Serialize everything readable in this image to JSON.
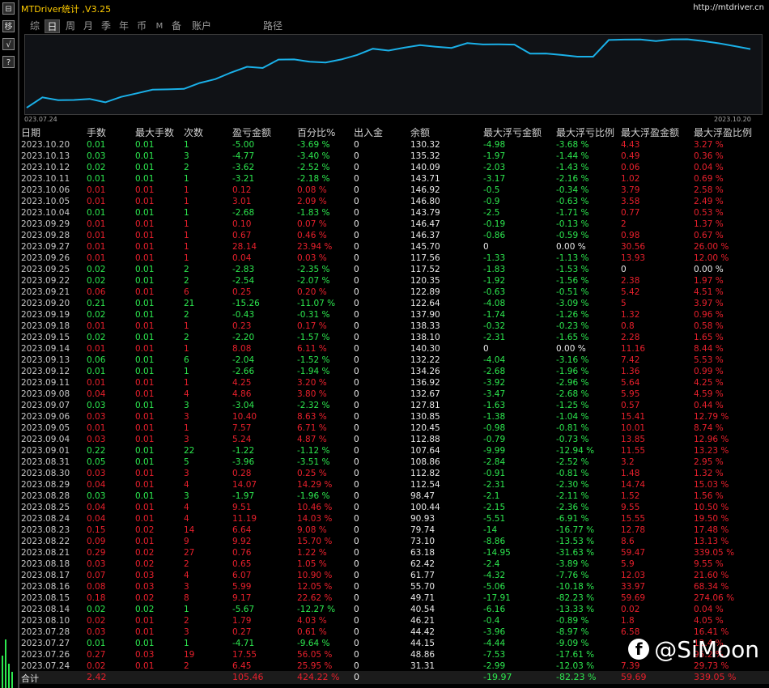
{
  "app": {
    "title": "MTDriver统计 ,V3.25",
    "url": "http://mtdriver.cn",
    "left_buttons": [
      "⊟",
      "移",
      "√",
      "?"
    ]
  },
  "tabs": [
    "综",
    "日",
    "周",
    "月",
    "季",
    "年",
    "币",
    "M",
    "备",
    "账户",
    "路径"
  ],
  "active_tab": "日",
  "chart": {
    "start_label": "023.07.24",
    "end_label": "2023.10.20",
    "line_color": "#1ab0e8"
  },
  "columns": [
    "日期",
    "手数",
    "最大手数",
    "次数",
    "盈亏金额",
    "百分比%",
    "出入金",
    "余额",
    "最大浮亏金额",
    "最大浮亏比例",
    "最大浮盈金额",
    "最大浮盈比例"
  ],
  "rows": [
    [
      "2023.10.20",
      "0.01",
      "0.01",
      "1",
      "-5.00",
      "-3.69 %",
      "0",
      "130.32",
      "-4.98",
      "-3.68 %",
      "4.43",
      "3.27 %"
    ],
    [
      "2023.10.13",
      "0.03",
      "0.01",
      "3",
      "-4.77",
      "-3.40 %",
      "0",
      "135.32",
      "-1.97",
      "-1.44 %",
      "0.49",
      "0.36 %"
    ],
    [
      "2023.10.12",
      "0.02",
      "0.01",
      "2",
      "-3.62",
      "-2.52 %",
      "0",
      "140.09",
      "-2.03",
      "-1.43 %",
      "0.06",
      "0.04 %"
    ],
    [
      "2023.10.11",
      "0.01",
      "0.01",
      "1",
      "-3.21",
      "-2.18 %",
      "0",
      "143.71",
      "-3.17",
      "-2.16 %",
      "1.02",
      "0.69 %"
    ],
    [
      "2023.10.06",
      "0.01",
      "0.01",
      "1",
      "0.12",
      "0.08 %",
      "0",
      "146.92",
      "-0.5",
      "-0.34 %",
      "3.79",
      "2.58 %"
    ],
    [
      "2023.10.05",
      "0.01",
      "0.01",
      "1",
      "3.01",
      "2.09 %",
      "0",
      "146.80",
      "-0.9",
      "-0.63 %",
      "3.58",
      "2.49 %"
    ],
    [
      "2023.10.04",
      "0.01",
      "0.01",
      "1",
      "-2.68",
      "-1.83 %",
      "0",
      "143.79",
      "-2.5",
      "-1.71 %",
      "0.77",
      "0.53 %"
    ],
    [
      "2023.09.29",
      "0.01",
      "0.01",
      "1",
      "0.10",
      "0.07 %",
      "0",
      "146.47",
      "-0.19",
      "-0.13 %",
      "2",
      "1.37 %"
    ],
    [
      "2023.09.28",
      "0.01",
      "0.01",
      "1",
      "0.67",
      "0.46 %",
      "0",
      "146.37",
      "-0.86",
      "-0.59 %",
      "0.98",
      "0.67 %"
    ],
    [
      "2023.09.27",
      "0.01",
      "0.01",
      "1",
      "28.14",
      "23.94 %",
      "0",
      "145.70",
      "0",
      "0.00 %",
      "30.56",
      "26.00 %"
    ],
    [
      "2023.09.26",
      "0.01",
      "0.01",
      "1",
      "0.04",
      "0.03 %",
      "0",
      "117.56",
      "-1.33",
      "-1.13 %",
      "13.93",
      "12.00 %"
    ],
    [
      "2023.09.25",
      "0.02",
      "0.01",
      "2",
      "-2.83",
      "-2.35 %",
      "0",
      "117.52",
      "-1.83",
      "-1.53 %",
      "0",
      "0.00 %"
    ],
    [
      "2023.09.22",
      "0.02",
      "0.01",
      "2",
      "-2.54",
      "-2.07 %",
      "0",
      "120.35",
      "-1.92",
      "-1.56 %",
      "2.38",
      "1.97 %"
    ],
    [
      "2023.09.21",
      "0.06",
      "0.01",
      "6",
      "0.25",
      "0.20 %",
      "0",
      "122.89",
      "-0.63",
      "-0.51 %",
      "5.42",
      "4.51 %"
    ],
    [
      "2023.09.20",
      "0.21",
      "0.01",
      "21",
      "-15.26",
      "-11.07 %",
      "0",
      "122.64",
      "-4.08",
      "-3.09 %",
      "5",
      "3.97 %"
    ],
    [
      "2023.09.19",
      "0.02",
      "0.01",
      "2",
      "-0.43",
      "-0.31 %",
      "0",
      "137.90",
      "-1.74",
      "-1.26 %",
      "1.32",
      "0.96 %"
    ],
    [
      "2023.09.18",
      "0.01",
      "0.01",
      "1",
      "0.23",
      "0.17 %",
      "0",
      "138.33",
      "-0.32",
      "-0.23 %",
      "0.8",
      "0.58 %"
    ],
    [
      "2023.09.15",
      "0.02",
      "0.01",
      "2",
      "-2.20",
      "-1.57 %",
      "0",
      "138.10",
      "-2.31",
      "-1.65 %",
      "2.28",
      "1.65 %"
    ],
    [
      "2023.09.14",
      "0.01",
      "0.01",
      "1",
      "8.08",
      "6.11 %",
      "0",
      "140.30",
      "0",
      "0.00 %",
      "11.16",
      "8.44 %"
    ],
    [
      "2023.09.13",
      "0.06",
      "0.01",
      "6",
      "-2.04",
      "-1.52 %",
      "0",
      "132.22",
      "-4.04",
      "-3.16 %",
      "7.42",
      "5.53 %"
    ],
    [
      "2023.09.12",
      "0.01",
      "0.01",
      "1",
      "-2.66",
      "-1.94 %",
      "0",
      "134.26",
      "-2.68",
      "-1.96 %",
      "1.36",
      "0.99 %"
    ],
    [
      "2023.09.11",
      "0.01",
      "0.01",
      "1",
      "4.25",
      "3.20 %",
      "0",
      "136.92",
      "-3.92",
      "-2.96 %",
      "5.64",
      "4.25 %"
    ],
    [
      "2023.09.08",
      "0.04",
      "0.01",
      "4",
      "4.86",
      "3.80 %",
      "0",
      "132.67",
      "-3.47",
      "-2.68 %",
      "5.95",
      "4.59 %"
    ],
    [
      "2023.09.07",
      "0.03",
      "0.01",
      "3",
      "-3.04",
      "-2.32 %",
      "0",
      "127.81",
      "-1.63",
      "-1.25 %",
      "0.57",
      "0.44 %"
    ],
    [
      "2023.09.06",
      "0.03",
      "0.01",
      "3",
      "10.40",
      "8.63 %",
      "0",
      "130.85",
      "-1.38",
      "-1.04 %",
      "15.41",
      "12.79 %"
    ],
    [
      "2023.09.05",
      "0.01",
      "0.01",
      "1",
      "7.57",
      "6.71 %",
      "0",
      "120.45",
      "-0.98",
      "-0.81 %",
      "10.01",
      "8.74 %"
    ],
    [
      "2023.09.04",
      "0.03",
      "0.01",
      "3",
      "5.24",
      "4.87 %",
      "0",
      "112.88",
      "-0.79",
      "-0.73 %",
      "13.85",
      "12.96 %"
    ],
    [
      "2023.09.01",
      "0.22",
      "0.01",
      "22",
      "-1.22",
      "-1.12 %",
      "0",
      "107.64",
      "-9.99",
      "-12.94 %",
      "11.55",
      "13.23 %"
    ],
    [
      "2023.08.31",
      "0.05",
      "0.01",
      "5",
      "-3.96",
      "-3.51 %",
      "0",
      "108.86",
      "-2.84",
      "-2.52 %",
      "3.2",
      "2.95 %"
    ],
    [
      "2023.08.30",
      "0.03",
      "0.01",
      "3",
      "0.28",
      "0.25 %",
      "0",
      "112.82",
      "-0.91",
      "-0.81 %",
      "1.48",
      "1.32 %"
    ],
    [
      "2023.08.29",
      "0.04",
      "0.01",
      "4",
      "14.07",
      "14.29 %",
      "0",
      "112.54",
      "-2.31",
      "-2.30 %",
      "14.74",
      "15.03 %"
    ],
    [
      "2023.08.28",
      "0.03",
      "0.01",
      "3",
      "-1.97",
      "-1.96 %",
      "0",
      "98.47",
      "-2.1",
      "-2.11 %",
      "1.52",
      "1.56 %"
    ],
    [
      "2023.08.25",
      "0.04",
      "0.01",
      "4",
      "9.51",
      "10.46 %",
      "0",
      "100.44",
      "-2.15",
      "-2.36 %",
      "9.55",
      "10.50 %"
    ],
    [
      "2023.08.24",
      "0.04",
      "0.01",
      "4",
      "11.19",
      "14.03 %",
      "0",
      "90.93",
      "-5.51",
      "-6.91 %",
      "15.55",
      "19.50 %"
    ],
    [
      "2023.08.23",
      "0.15",
      "0.02",
      "14",
      "6.64",
      "9.08 %",
      "0",
      "79.74",
      "-14",
      "-16.77 %",
      "12.78",
      "17.48 %"
    ],
    [
      "2023.08.22",
      "0.09",
      "0.01",
      "9",
      "9.92",
      "15.70 %",
      "0",
      "73.10",
      "-8.86",
      "-13.53 %",
      "8.6",
      "13.13 %"
    ],
    [
      "2023.08.21",
      "0.29",
      "0.02",
      "27",
      "0.76",
      "1.22 %",
      "0",
      "63.18",
      "-14.95",
      "-31.63 %",
      "59.47",
      "339.05 %"
    ],
    [
      "2023.08.18",
      "0.03",
      "0.02",
      "2",
      "0.65",
      "1.05 %",
      "0",
      "62.42",
      "-2.4",
      "-3.89 %",
      "5.9",
      "9.55 %"
    ],
    [
      "2023.08.17",
      "0.07",
      "0.03",
      "4",
      "6.07",
      "10.90 %",
      "0",
      "61.77",
      "-4.32",
      "-7.76 %",
      "12.03",
      "21.60 %"
    ],
    [
      "2023.08.16",
      "0.08",
      "0.03",
      "3",
      "5.99",
      "12.05 %",
      "0",
      "55.70",
      "-5.06",
      "-10.18 %",
      "33.97",
      "68.34 %"
    ],
    [
      "2023.08.15",
      "0.18",
      "0.02",
      "8",
      "9.17",
      "22.62 %",
      "0",
      "49.71",
      "-17.91",
      "-82.23 %",
      "59.69",
      "274.06 %"
    ],
    [
      "2023.08.14",
      "0.02",
      "0.02",
      "1",
      "-5.67",
      "-12.27 %",
      "0",
      "40.54",
      "-6.16",
      "-13.33 %",
      "0.02",
      "0.04 %"
    ],
    [
      "2023.08.10",
      "0.02",
      "0.01",
      "2",
      "1.79",
      "4.03 %",
      "0",
      "46.21",
      "-0.4",
      "-0.89 %",
      "1.8",
      "4.05 %"
    ],
    [
      "2023.07.28",
      "0.03",
      "0.01",
      "3",
      "0.27",
      "0.61 %",
      "0",
      "44.42",
      "-3.96",
      "-8.97 %",
      "6.58",
      "16.41 %"
    ],
    [
      "2023.07.27",
      "0.01",
      "0.01",
      "1",
      "-4.71",
      "-9.64 %",
      "0",
      "44.15",
      "-4.44",
      "-9.09 %",
      "",
      "12.4 %"
    ],
    [
      "2023.07.26",
      "0.27",
      "0.03",
      "19",
      "17.55",
      "56.05 %",
      "0",
      "48.86",
      "-7.53",
      "-17.61 %",
      "",
      "95.2 %"
    ],
    [
      "2023.07.24",
      "0.02",
      "0.01",
      "2",
      "6.45",
      "25.95 %",
      "0",
      "31.31",
      "-2.99",
      "-12.03 %",
      "7.39",
      "29.73 %"
    ]
  ],
  "footer": {
    "label": "合计",
    "lots": "2.42",
    "profit": "105.46",
    "percent": "424.22 %",
    "cash": "0",
    "max_float_loss": "-19.97",
    "max_float_loss_pct": "-82.23 %",
    "max_float_profit": "59.69",
    "max_float_profit_pct": "339.05 %"
  },
  "watermark": {
    "icon": "f",
    "text": "@SiMoon"
  },
  "colors": {
    "gain": "#e8202c",
    "loss": "#2de84f",
    "accent_title": "#ffcc00"
  }
}
